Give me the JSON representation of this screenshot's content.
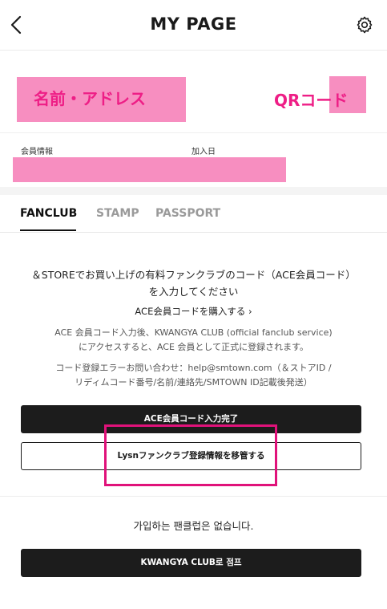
{
  "header": {
    "title": "MY PAGE",
    "back_icon": "chevron-left-icon",
    "settings_icon": "gear-icon"
  },
  "profile": {
    "name_overlay": "名前・アドレス",
    "qr_overlay": "QRコード",
    "member_info_label": "会員情報",
    "join_date_label": "加入日",
    "redaction_color": "#f78ec0",
    "overlay_text_color": "#ee1e86"
  },
  "tabs": [
    {
      "label": "FANCLUB",
      "active": true
    },
    {
      "label": "STAMP",
      "active": false
    },
    {
      "label": "PASSPORT",
      "active": false
    }
  ],
  "fanclub": {
    "notice_line1": "＆STOREでお買い上げの有料ファンクラブのコード（ACE会員コード）",
    "notice_line2": "を入力してください",
    "buy_link": "ACE会員コードを購入する ›",
    "desc_line1": "ACE 会員コード入力後、KWANGYA CLUB (official fanclub service)",
    "desc_line2": "にアクセスすると、ACE 会員として正式に登録されます。",
    "error_line1": "コード登録エラーお問い合わせ：help@smtown.com（＆ストアID /",
    "error_line2": "リディムコード番号/名前/連絡先/SMTOWN ID記載後発送）",
    "complete_button": "ACE会員コード入力完了",
    "transfer_button": "Lysnファンクラブ登録情報を移管する",
    "highlight_color": "#e0127a"
  },
  "bottom": {
    "no_club_text": "가입하는 팬클럽은 없습니다.",
    "kwangya_button": "KWANGYA CLUB로 점프"
  }
}
